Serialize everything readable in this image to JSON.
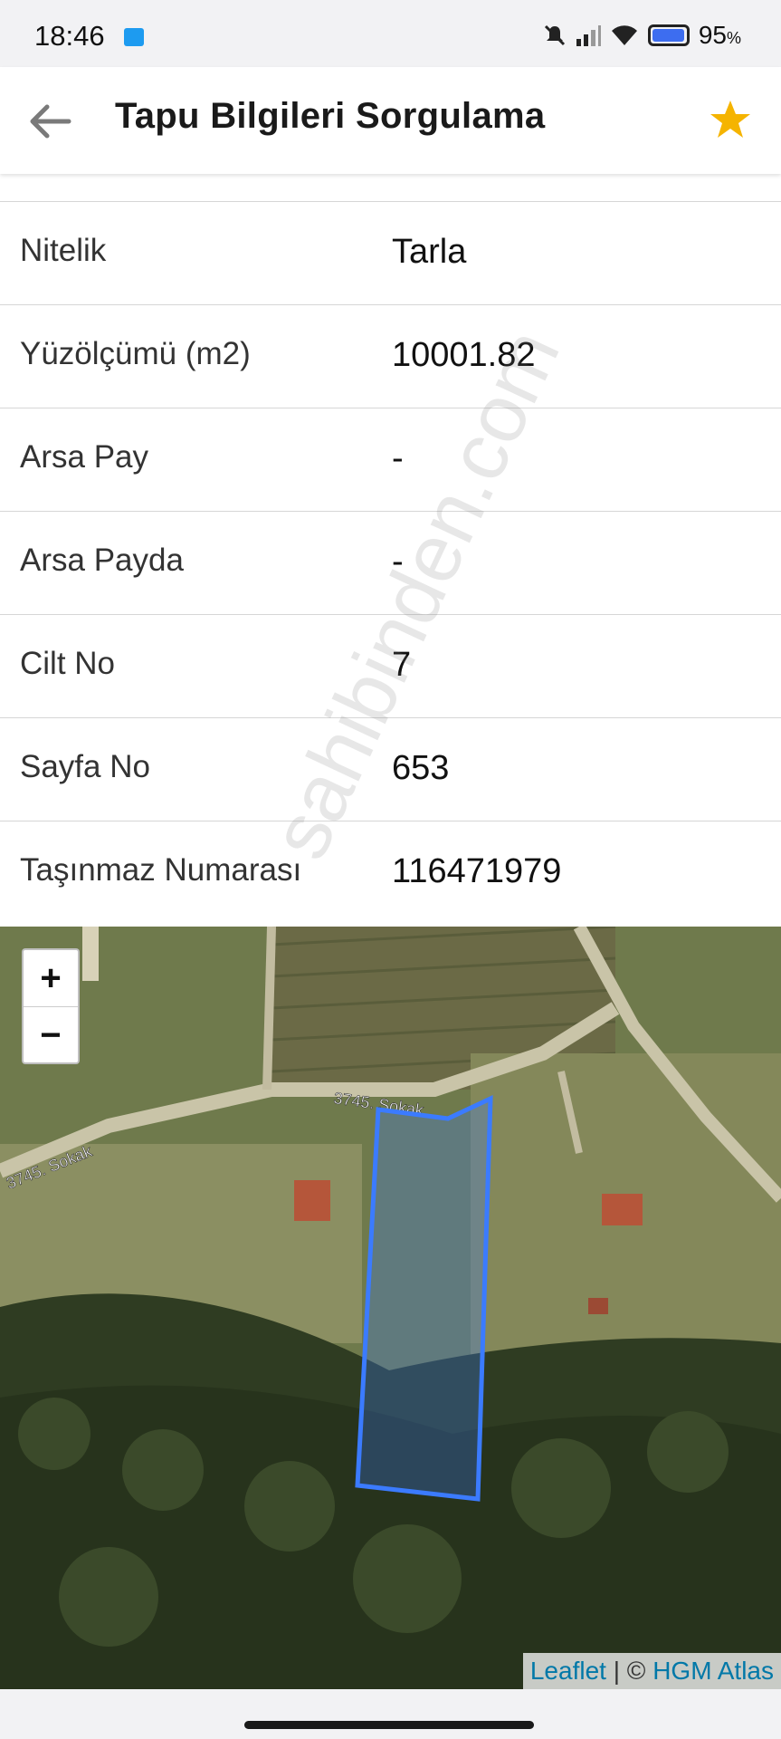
{
  "status_bar": {
    "time": "18:46",
    "battery": "95",
    "battery_unit": "%"
  },
  "app_bar": {
    "title": "Tapu Bilgileri Sorgulama"
  },
  "rows": [
    {
      "label": "Nitelik",
      "value": "Tarla"
    },
    {
      "label": "Yüzölçümü (m2)",
      "value": "10001.82"
    },
    {
      "label": "Arsa Pay",
      "value": "-"
    },
    {
      "label": "Arsa Payda",
      "value": "-"
    },
    {
      "label": "Cilt No",
      "value": "7"
    },
    {
      "label": "Sayfa No",
      "value": "653"
    },
    {
      "label": "Taşınmaz Numarası",
      "value": "116471979"
    }
  ],
  "map": {
    "zoom_in": "+",
    "zoom_out": "−",
    "road_labels": [
      "3745. Sokak",
      "3745. Sokak"
    ],
    "attribution": {
      "leaflet": "Leaflet",
      "separator": " | © ",
      "provider": "HGM Atlas"
    },
    "parcel_color": "#3b7bff"
  },
  "watermark": "sahibinden.com",
  "colors": {
    "star": "#f5b400",
    "back_arrow": "#7a7a7a"
  }
}
